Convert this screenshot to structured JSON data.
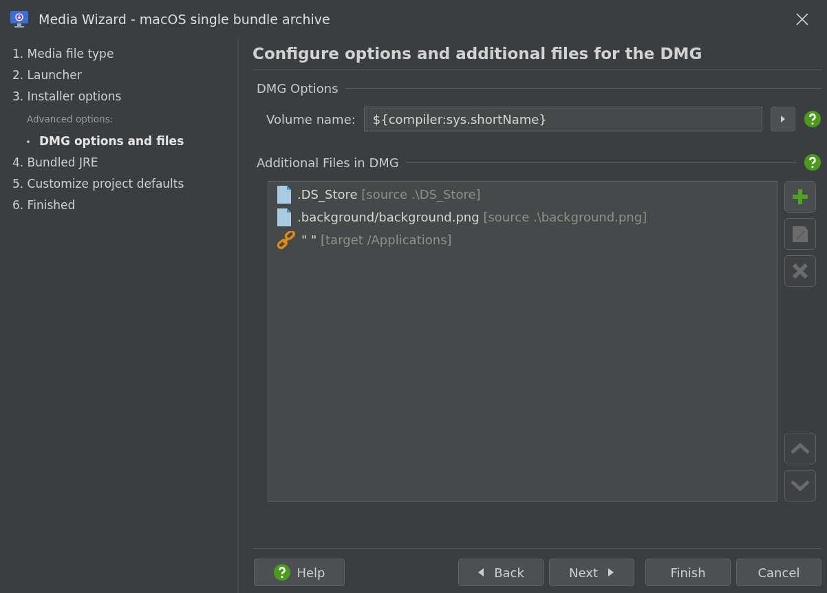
{
  "window": {
    "title": "Media Wizard - macOS single bundle archive"
  },
  "steps": [
    {
      "kind": "step",
      "label": "1. Media file type",
      "selected": false
    },
    {
      "kind": "step",
      "label": "2. Launcher",
      "selected": false
    },
    {
      "kind": "step",
      "label": "3. Installer options",
      "selected": false
    },
    {
      "kind": "heading",
      "label": "Advanced options:"
    },
    {
      "kind": "sub",
      "label": "DMG options and files",
      "selected": true
    },
    {
      "kind": "step",
      "label": "4. Bundled JRE",
      "selected": false
    },
    {
      "kind": "step",
      "label": "5. Customize project defaults",
      "selected": false
    },
    {
      "kind": "step",
      "label": "6. Finished",
      "selected": false
    }
  ],
  "page_title": "Configure options and additional files for the DMG",
  "options": {
    "title": "DMG Options",
    "label": "Volume name:",
    "value": "${compiler:sys.shortName}"
  },
  "files": {
    "title": "Additional Files in DMG",
    "rows": [
      {
        "kind": "file",
        "name": ".DS_Store",
        "detail": "[source .\\DS_Store]"
      },
      {
        "kind": "file",
        "name": ".background/background.png",
        "detail": "[source .\\background.png]"
      },
      {
        "kind": "link",
        "name": "\" \"",
        "detail": "[target /Applications]"
      }
    ],
    "tools": [
      {
        "kind": "add",
        "disabled": false
      },
      {
        "kind": "edit",
        "disabled": true
      },
      {
        "kind": "delete",
        "disabled": true
      },
      {
        "kind": "up",
        "disabled": true
      },
      {
        "kind": "down",
        "disabled": true
      }
    ]
  },
  "buttons": {
    "help": "Help",
    "back": "Back",
    "next": "Next",
    "finish": "Finish",
    "cancel": "Cancel"
  }
}
